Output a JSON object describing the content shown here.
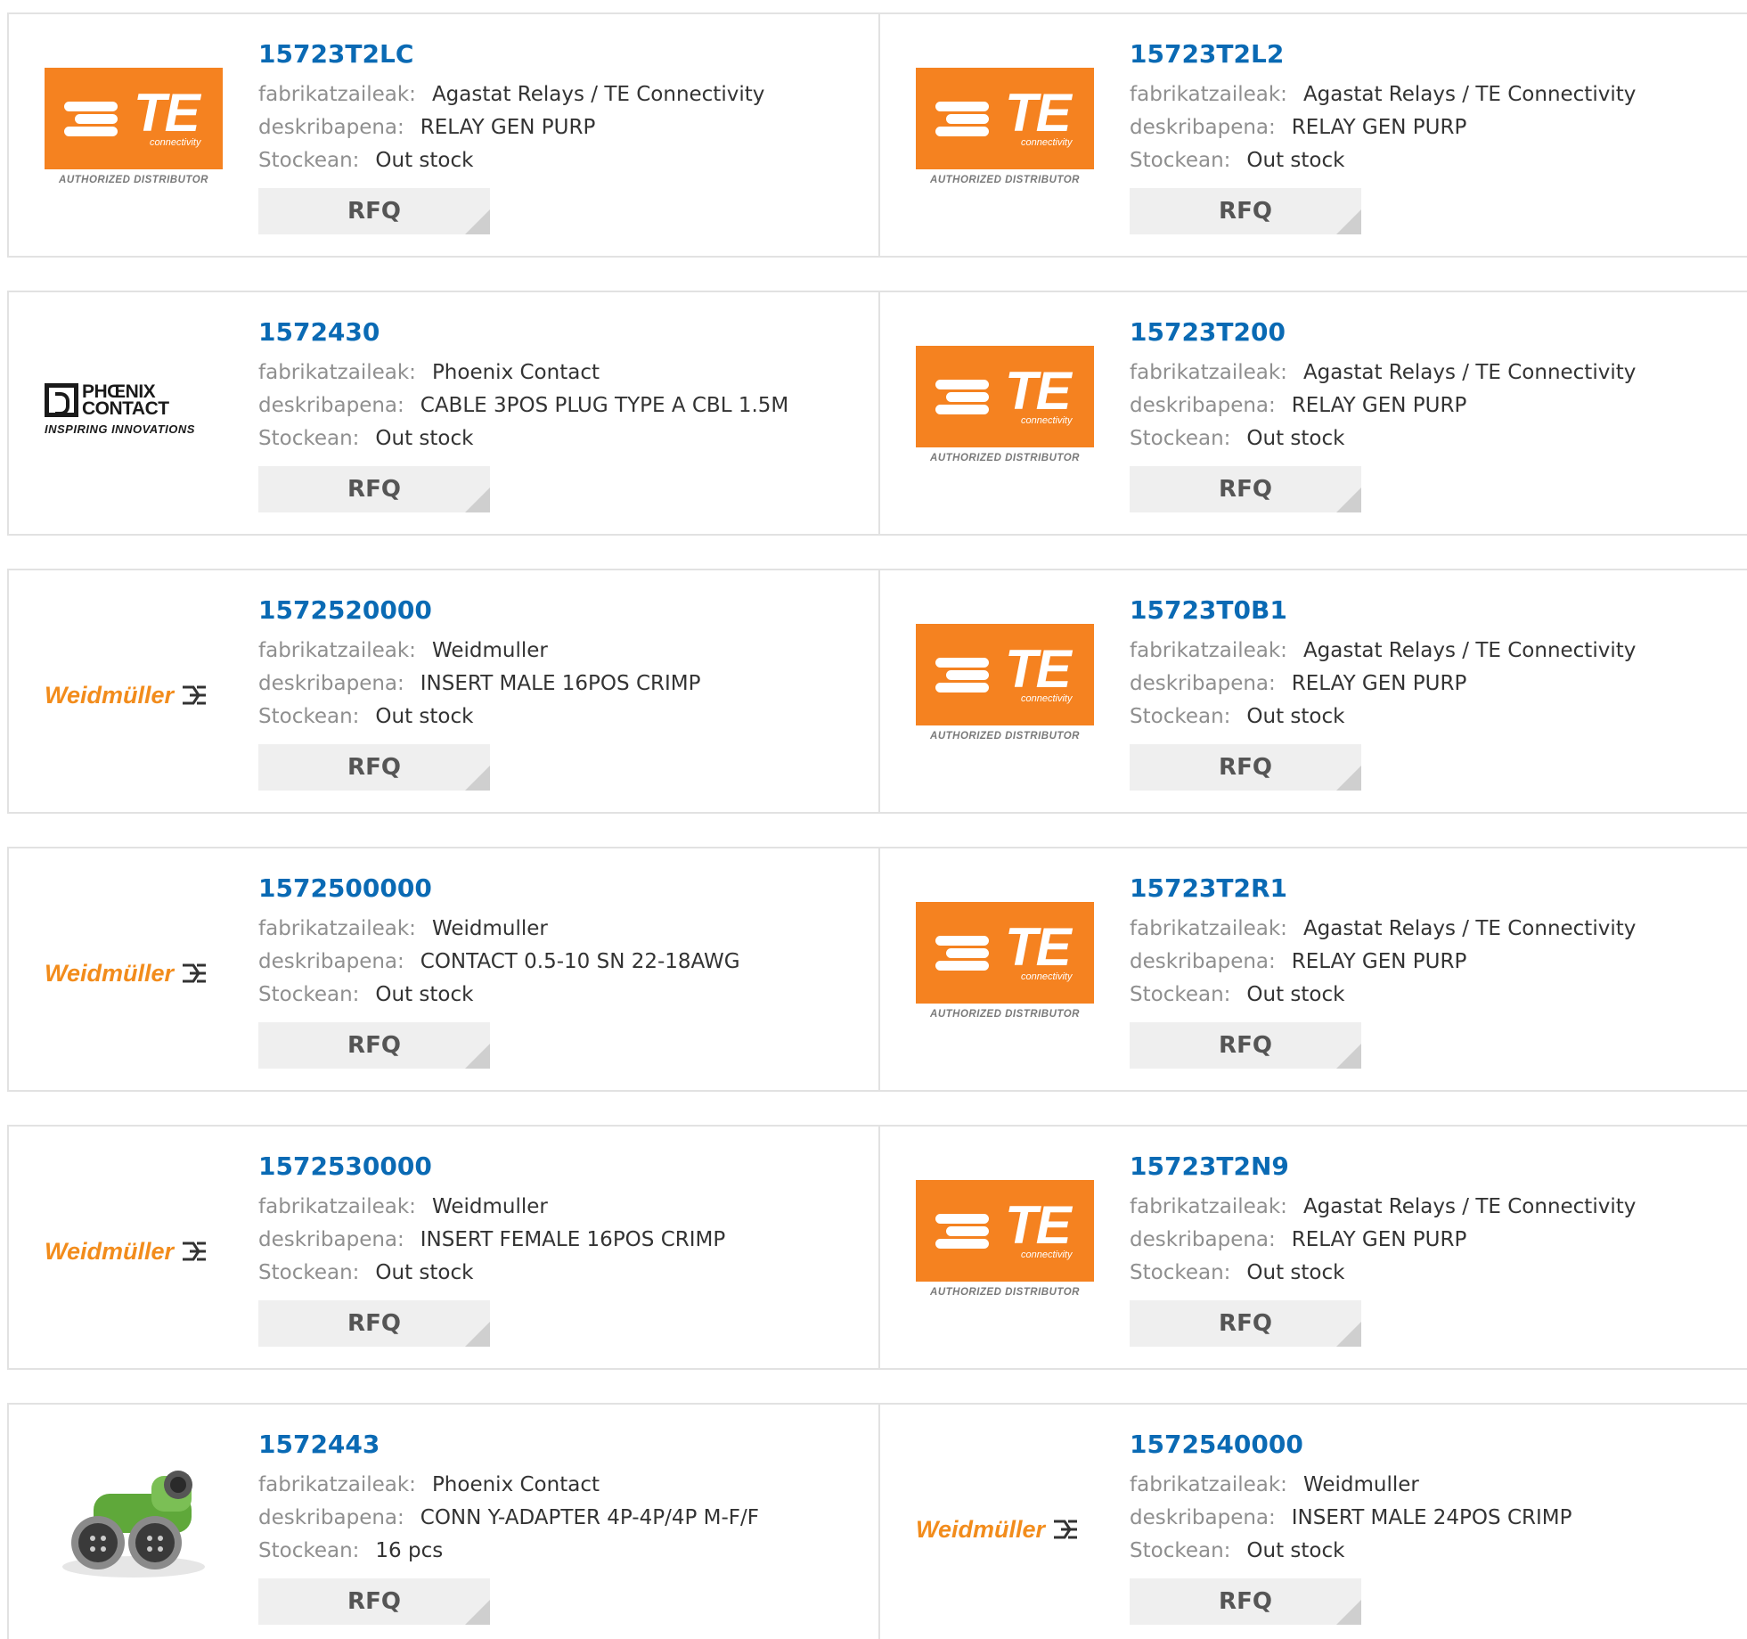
{
  "labels": {
    "manufacturer": "fabrikatzaileak:",
    "description": "deskribapena:",
    "stock": "Stockean:",
    "rfq": "RFQ"
  },
  "logo_text": {
    "te": "TE",
    "te_sub": "connectivity",
    "te_authorized": "AUTHORIZED DISTRIBUTOR",
    "weidmuller": "Weidmüller",
    "phoenix_line1": "PHŒNIX",
    "phoenix_line2": "CONTACT",
    "phoenix_sub": "INSPIRING INNOVATIONS"
  },
  "colors": {
    "part_number": "#0a6ab4",
    "te_orange": "#f58220",
    "weidmuller_orange": "#f28c1c",
    "rfq_bg": "#efefef"
  },
  "products": [
    {
      "part": "15723T2LC",
      "manufacturer": "Agastat Relays / TE Connectivity",
      "description": "RELAY GEN PURP",
      "stock": "Out stock",
      "logo": "te"
    },
    {
      "part": "15723T2L2",
      "manufacturer": "Agastat Relays / TE Connectivity",
      "description": "RELAY GEN PURP",
      "stock": "Out stock",
      "logo": "te"
    },
    {
      "part": "1572430",
      "manufacturer": "Phoenix Contact",
      "description": "CABLE 3POS PLUG TYPE A CBL 1.5M",
      "stock": "Out stock",
      "logo": "phoenix"
    },
    {
      "part": "15723T200",
      "manufacturer": "Agastat Relays / TE Connectivity",
      "description": "RELAY GEN PURP",
      "stock": "Out stock",
      "logo": "te"
    },
    {
      "part": "1572520000",
      "manufacturer": "Weidmuller",
      "description": "INSERT MALE 16POS CRIMP",
      "stock": "Out stock",
      "logo": "weidmuller"
    },
    {
      "part": "15723T0B1",
      "manufacturer": "Agastat Relays / TE Connectivity",
      "description": "RELAY GEN PURP",
      "stock": "Out stock",
      "logo": "te"
    },
    {
      "part": "1572500000",
      "manufacturer": "Weidmuller",
      "description": "CONTACT 0.5-10 SN 22-18AWG",
      "stock": "Out stock",
      "logo": "weidmuller"
    },
    {
      "part": "15723T2R1",
      "manufacturer": "Agastat Relays / TE Connectivity",
      "description": "RELAY GEN PURP",
      "stock": "Out stock",
      "logo": "te"
    },
    {
      "part": "1572530000",
      "manufacturer": "Weidmuller",
      "description": "INSERT FEMALE 16POS CRIMP",
      "stock": "Out stock",
      "logo": "weidmuller"
    },
    {
      "part": "15723T2N9",
      "manufacturer": "Agastat Relays / TE Connectivity",
      "description": "RELAY GEN PURP",
      "stock": "Out stock",
      "logo": "te"
    },
    {
      "part": "1572443",
      "manufacturer": "Phoenix Contact",
      "description": "CONN Y-ADAPTER 4P-4P/4P M-F/F",
      "stock": "16 pcs",
      "logo": "product-photo"
    },
    {
      "part": "1572540000",
      "manufacturer": "Weidmuller",
      "description": "INSERT MALE 24POS CRIMP",
      "stock": "Out stock",
      "logo": "weidmuller"
    }
  ]
}
